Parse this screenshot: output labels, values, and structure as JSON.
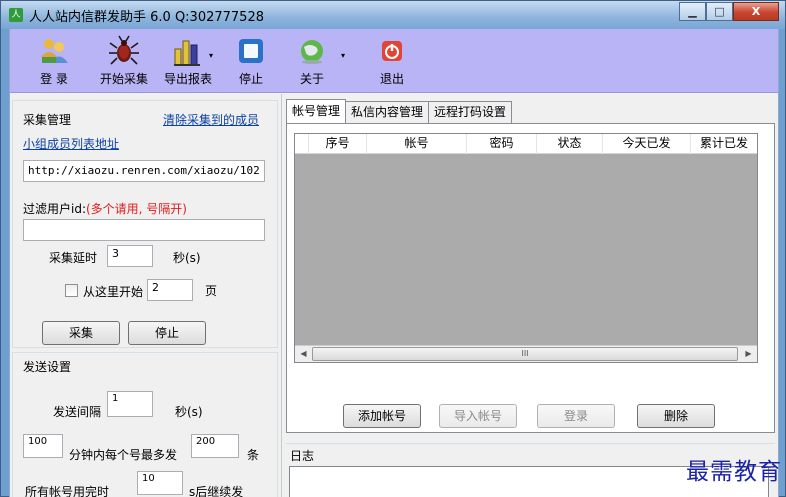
{
  "window": {
    "title": "人人站内信群发助手 6.0 Q:302777528",
    "icon_text": "人",
    "controls": [
      "minimize-icon",
      "maximize-icon",
      "close-icon"
    ],
    "min_glyph": "▁",
    "max_glyph": "□",
    "close_glyph": "X"
  },
  "toolbar": {
    "items": [
      {
        "label": "登 录",
        "icon": "users-icon"
      },
      {
        "label": "开始采集",
        "icon": "bug-icon"
      },
      {
        "label": "导出报表",
        "icon": "bar-chart-icon",
        "dropdown": true
      },
      {
        "label": "停止",
        "icon": "stop-icon"
      },
      {
        "label": "关于",
        "icon": "globe-icon",
        "dropdown": true
      },
      {
        "label": "退出",
        "icon": "power-icon"
      }
    ]
  },
  "collect": {
    "title": "采集管理",
    "clear_link": "清除采集到的成员",
    "member_list_link": "小组成员列表地址",
    "url_value": "http://xiaozu.renren.com/xiaozu/102",
    "filter_label": "过滤用户id:",
    "filter_hint": "(多个请用, 号隔开)",
    "filter_value": "",
    "delay_label": "采集延时",
    "delay_value": "3",
    "delay_unit": "秒(s)",
    "start_here_label": "从这里开始",
    "start_page_value": "2",
    "page_unit": "页",
    "collect_button": "采集",
    "stop_button": "停止"
  },
  "send": {
    "title": "发送设置",
    "interval_label": "发送间隔",
    "interval_value": "1",
    "interval_unit": "秒(s)",
    "minutes_value": "100",
    "per_account_label": "分钟内每个号最多发",
    "max_value": "200",
    "max_unit": "条",
    "all_used_label": "所有帐号用完时",
    "resume_value": "10",
    "resume_label": "s后继续发"
  },
  "tabs": [
    "帐号管理",
    "私信内容管理",
    "远程打码设置"
  ],
  "account_table": {
    "columns": [
      "序号",
      "帐号",
      "密码",
      "状态",
      "今天已发",
      "累计已发"
    ],
    "rows": [],
    "scroll_glyph": "III",
    "scroll_left": "◀",
    "scroll_right": "▶"
  },
  "account_buttons": {
    "add": "添加帐号",
    "import": "导入帐号",
    "login": "登录",
    "delete": "删除"
  },
  "log": {
    "title": "日志",
    "content": ""
  },
  "watermark": "最需教育"
}
